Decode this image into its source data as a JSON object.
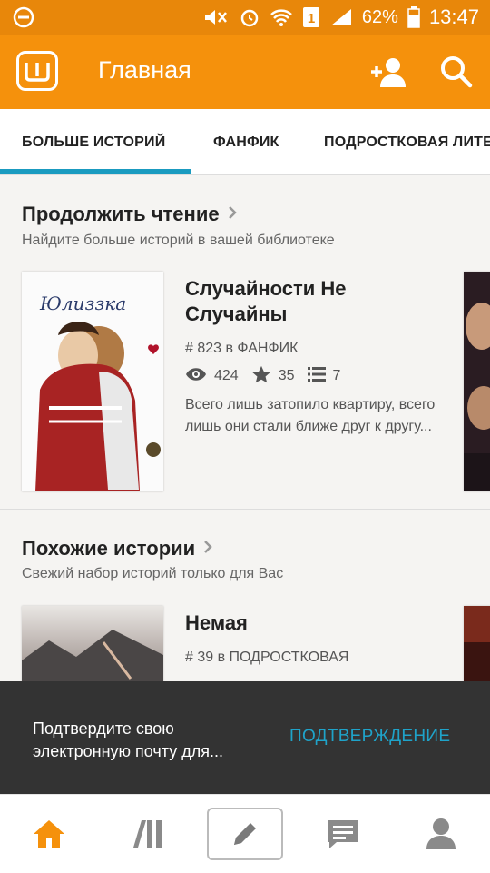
{
  "status_bar": {
    "battery": "62%",
    "time": "13:47",
    "icons": [
      "minus-circle-icon",
      "mute-icon",
      "alarm-icon",
      "wifi-icon",
      "sim-icon",
      "signal-icon",
      "battery-icon"
    ]
  },
  "app_bar": {
    "title": "Главная",
    "logo_icon": "wattpad-logo-icon",
    "actions": [
      "add-user-icon",
      "search-icon"
    ]
  },
  "tabs": [
    {
      "label": "БОЛЬШЕ ИСТОРИЙ",
      "active": true
    },
    {
      "label": "ФАНФИК",
      "active": false
    },
    {
      "label": "ПОДРОСТКОВАЯ ЛИТЕРАТУРА",
      "active": false
    }
  ],
  "continue_reading": {
    "title": "Продолжить чтение",
    "subtitle": "Найдите больше историй в вашей библиотеке",
    "story": {
      "title": "Случайности Не Случайны",
      "cover_text": "Юлиззка",
      "rank": "# 823 в ФАНФИК",
      "reads": "424",
      "votes": "35",
      "parts": "7",
      "description": "Всего лишь затопило квартиру, всего лишь они стали ближе друг к другу..."
    }
  },
  "similar": {
    "title": "Похожие истории",
    "subtitle": "Свежий набор историй только для Вас",
    "story": {
      "title": "Немая",
      "rank": "# 39 в ПОДРОСТКОВАЯ"
    }
  },
  "snackbar": {
    "message": "Подтвердите свою электронную почту для...",
    "action": "ПОДТВЕРЖДЕНИЕ"
  },
  "bottom_nav": [
    "home-icon",
    "library-icon",
    "write-icon",
    "messages-icon",
    "profile-icon"
  ],
  "colors": {
    "status_bar": "#e8870a",
    "app_bar": "#f5910c",
    "accent": "#1a9bc0",
    "snackbar": "#333333",
    "home_active": "#f5910c"
  }
}
